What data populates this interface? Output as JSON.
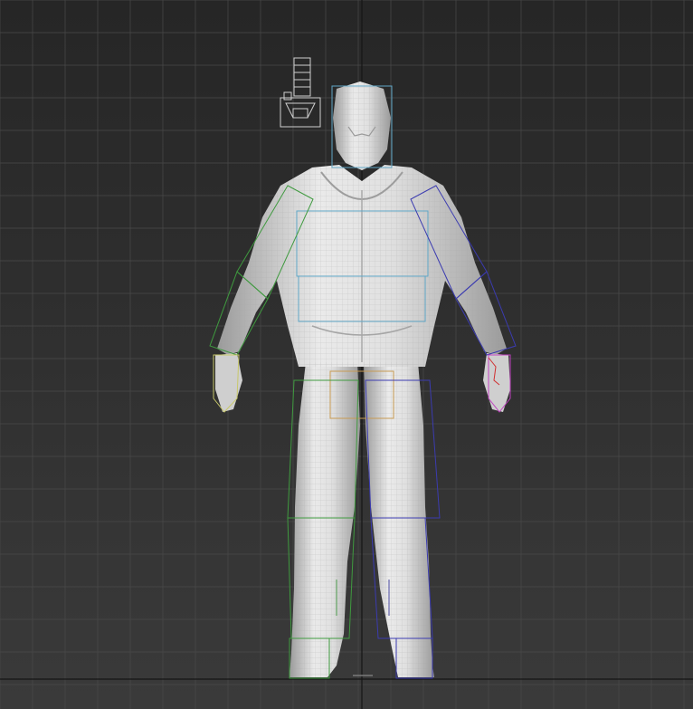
{
  "viewport": {
    "background_top": "#262626",
    "background_bottom": "#3a3a3a",
    "grid_color": "#4a4a4a",
    "axis_color": "#141414"
  },
  "model": {
    "mesh_fill": "#d9d9d9",
    "mesh_shadow": "#8e8e8e",
    "wire_color": "#b4b4b4"
  },
  "rig": {
    "spine_color": "#5fa6c6",
    "left_side_color": "#3f9a3f",
    "right_side_color": "#3b3bb0",
    "pelvis_color": "#c79a52",
    "left_hand_color": "#c8c86a",
    "right_hand_color": "#c040c0",
    "right_finger_color": "#d03030"
  },
  "camera": {
    "icon": "camera-icon",
    "color": "#cfcfcf"
  }
}
